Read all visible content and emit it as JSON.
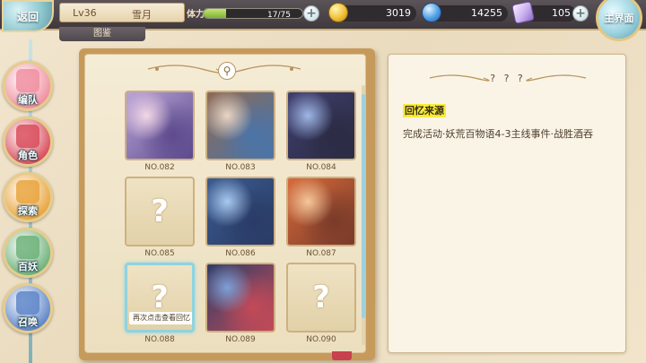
{
  "topbar": {
    "back_label": "返回",
    "level": "Lv36",
    "player_name": "雪月",
    "tab_label": "图鉴",
    "stamina_label": "体力",
    "stamina_text": "17/75",
    "stamina_fraction": 0.23,
    "coins": "3019",
    "gems": "14255",
    "tickets": "105",
    "main_label": "主界面"
  },
  "nav": {
    "items": [
      {
        "label": "编队",
        "icon": "team-icon",
        "color": "#f08fa0"
      },
      {
        "label": "角色",
        "icon": "character-icon",
        "color": "#d94d5c"
      },
      {
        "label": "探索",
        "icon": "explore-icon",
        "color": "#e9a53e"
      },
      {
        "label": "百妖",
        "icon": "monster-icon",
        "color": "#6fb27a"
      },
      {
        "label": "召唤",
        "icon": "summon-icon",
        "color": "#5e86c9"
      }
    ]
  },
  "gallery": {
    "cards": [
      {
        "label": "NO.082",
        "state": "unlocked",
        "art": "art-082"
      },
      {
        "label": "NO.083",
        "state": "unlocked",
        "art": "art-083"
      },
      {
        "label": "NO.084",
        "state": "unlocked",
        "art": "art-084"
      },
      {
        "label": "NO.085",
        "state": "locked"
      },
      {
        "label": "NO.086",
        "state": "unlocked",
        "art": "art-086"
      },
      {
        "label": "NO.087",
        "state": "unlocked",
        "art": "art-087"
      },
      {
        "label": "NO.088",
        "state": "locked",
        "selected": true
      },
      {
        "label": "NO.089",
        "state": "unlocked",
        "art": "art-089"
      },
      {
        "label": "NO.090",
        "state": "locked"
      }
    ],
    "locked_mark": "?",
    "tooltip": "再次点击查看回忆"
  },
  "detail": {
    "title": "? ? ?",
    "section_title": "回忆来源",
    "section_text": "完成活动·妖荒百物语4-3主线事件·战胜酒吞"
  },
  "colors": {
    "accent_gold": "#e6cc8b",
    "selected_border": "#8fd3e0",
    "highlight_yellow": "#f7ec37"
  }
}
